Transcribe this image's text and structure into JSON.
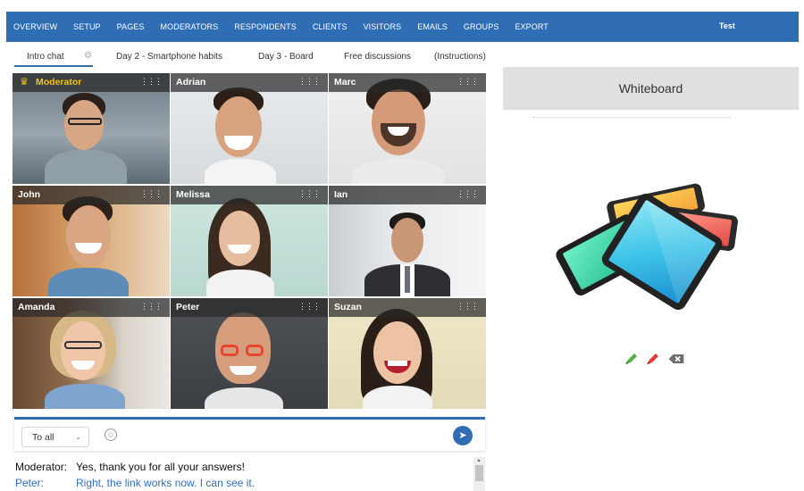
{
  "nav": {
    "items": [
      "OVERVIEW",
      "SETUP",
      "PAGES",
      "MODERATORS",
      "RESPONDENTS",
      "CLIENTS",
      "VISITORS",
      "EMAILS",
      "GROUPS",
      "EXPORT"
    ],
    "user": "Test"
  },
  "tabs": [
    {
      "label": "Intro chat",
      "active": true
    },
    {
      "label": "Day 2 - Smartphone habits",
      "active": false
    },
    {
      "label": "Day 3 - Board",
      "active": false
    },
    {
      "label": "Free discussions",
      "active": false
    },
    {
      "label": "(Instructions)",
      "active": false
    }
  ],
  "participants": [
    {
      "name": "Moderator",
      "role": "moderator"
    },
    {
      "name": "Adrian"
    },
    {
      "name": "Marc"
    },
    {
      "name": "John"
    },
    {
      "name": "Melissa"
    },
    {
      "name": "Ian"
    },
    {
      "name": "Amanda"
    },
    {
      "name": "Peter"
    },
    {
      "name": "Suzan"
    }
  ],
  "chat": {
    "recipient": "To all",
    "messages": [
      {
        "from": "Moderator:",
        "text": "Yes, thank you for all your answers!"
      },
      {
        "from": "Peter:",
        "text": "Right, the link works now. I can see it."
      }
    ]
  },
  "whiteboard": {
    "title": "Whiteboard"
  },
  "colors": {
    "accent": "#2f6db5",
    "moderator_name": "#f3c21a",
    "whiteboard_header": "#e0e0e0"
  },
  "icons": [
    "gear-icon",
    "crown-icon",
    "drag-handle-icon",
    "chevron-down-icon",
    "smiley-icon",
    "send-icon",
    "green-marker-icon",
    "red-marker-icon",
    "eraser-icon"
  ]
}
